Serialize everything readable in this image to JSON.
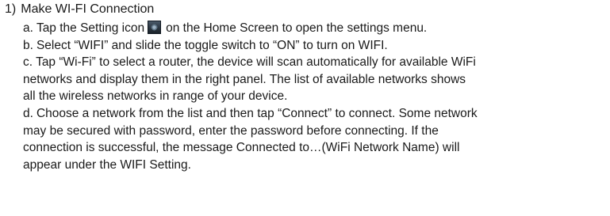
{
  "section": {
    "number": "1)",
    "title": "Make WI-FI Connection"
  },
  "steps": {
    "a": {
      "label": "a.",
      "text_before_icon": "Tap the Setting icon",
      "icon": "settings-app-icon",
      "text_after_icon": "on the Home Screen to open the settings menu."
    },
    "b": {
      "label": "b.",
      "text": "Select “WIFI” and slide the toggle switch to “ON” to turn on WIFI."
    },
    "c": {
      "label": "c.",
      "line1": "Tap “Wi-Fi” to select a router, the device will scan automatically for available WiFi",
      "line2": "networks and display them in the right panel. The list of available networks shows",
      "line3": "all the wireless networks in range of your device."
    },
    "d": {
      "label": "d.",
      "line1": "Choose a network from the list and then tap “Connect” to connect. Some network",
      "line2": "may be secured with password, enter the password before connecting. If the",
      "line3": "connection is successful, the message Connected to…(WiFi Network Name) will",
      "line4": "appear under the WIFI Setting."
    }
  }
}
